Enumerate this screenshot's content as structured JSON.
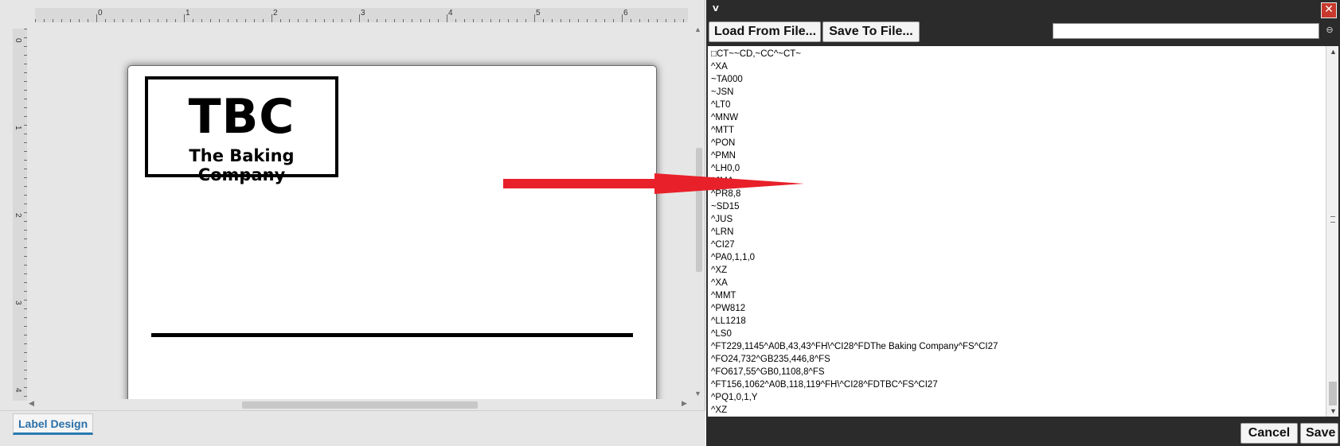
{
  "designer": {
    "ruler_top_numbers": [
      "0",
      "1",
      "2",
      "3",
      "4",
      "5",
      "6"
    ],
    "ruler_left_numbers": [
      "0",
      "1",
      "2",
      "3",
      "4"
    ],
    "label": {
      "logo_title": "TBC",
      "logo_subtitle": "The Baking Company"
    },
    "tabs": [
      {
        "label": "Label Design",
        "active": true
      }
    ]
  },
  "editor": {
    "toolbar": {
      "load_label": "Load From File...",
      "save_label": "Save To File...",
      "search_value": ""
    },
    "code_lines": [
      "□CT~~CD,~CC^~CT~",
      "^XA",
      "~TA000",
      "~JSN",
      "^LT0",
      "^MNW",
      "^MTT",
      "^PON",
      "^PMN",
      "^LH0,0",
      "^JMA",
      "^PR8,8",
      "~SD15",
      "^JUS",
      "^LRN",
      "^CI27",
      "^PA0,1,1,0",
      "^XZ",
      "^XA",
      "^MMT",
      "^PW812",
      "^LL1218",
      "^LS0",
      "^FT229,1145^A0B,43,43^FH\\^CI28^FDThe Baking Company^FS^CI27",
      "^FO24,732^GB235,446,8^FS",
      "^FO617,55^GB0,1108,8^FS",
      "^FT156,1062^A0B,118,119^FH\\^CI28^FDTBC^FS^CI27",
      "^PQ1,0,1,Y",
      "^XZ"
    ],
    "footer": {
      "cancel_label": "Cancel",
      "save_label": "Save"
    }
  },
  "colors": {
    "arrow": "#e8202a",
    "tab_accent": "#2a7ab0",
    "editor_bg": "#2b2b2b"
  }
}
